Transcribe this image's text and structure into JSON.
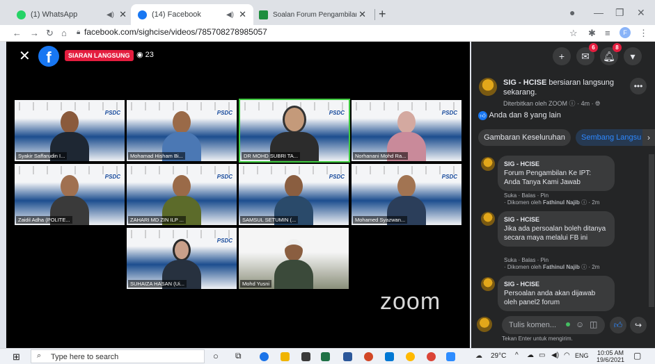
{
  "browser": {
    "tabs": [
      {
        "title": "(1) WhatsApp",
        "color": "#25d366"
      },
      {
        "title": "(14) Facebook",
        "color": "#1877f2"
      },
      {
        "title": "Soalan Forum Pengambilan ke IP",
        "color": "#1e8e3e"
      }
    ],
    "url": "facebook.com/sighcise/videos/785708278985057",
    "profile_initial": "F"
  },
  "video": {
    "live_label": "SIARAN LANGSUNG",
    "viewers": "23",
    "zoom_logo": "zoom",
    "tile_brand": "PSDC",
    "participants": [
      {
        "name": "Syakir Saffarudin I..."
      },
      {
        "name": "Mohamad Hisham Bi..."
      },
      {
        "name": "DR MOHD SUBRI TA..."
      },
      {
        "name": "Norhanani Mohd Ra..."
      },
      {
        "name": "Zaidil Adha (POLITE..."
      },
      {
        "name": "ZAHARI MD ZIN ILP ..."
      },
      {
        "name": "SAMSUL SETUMIN (..."
      },
      {
        "name": "Mohamed Syazwan..."
      },
      {
        "name": "SUHAIZA HASAN (Ui..."
      },
      {
        "name": "Mohd Yusni"
      }
    ]
  },
  "sidebar": {
    "badges": {
      "messenger": "6",
      "notifications": "8"
    },
    "post": {
      "page": "SIG - HCISE",
      "action": "bersiaran langsung sekarang.",
      "published": "Diterbitkan oleh ZOOM",
      "time": "4m",
      "reactions": "Anda dan 8 yang lain"
    },
    "tabs": [
      "Gambaran Keseluruhan",
      "Sembang Langsu"
    ],
    "comments": [
      {
        "author": "SIG - HCISE",
        "text": "Forum Pengambilan Ke IPT: Anda Tanya Kami Jawab",
        "actions": "Suka · Balas · Pin",
        "by_prefix": "· Dikomen oleh",
        "by": "Fathinul Najib",
        "time": "2m"
      },
      {
        "author": "SIG - HCISE",
        "text": "Jika ada persoalan boleh ditanya secara maya melalui FB ini",
        "actions": "Suka · Balas · Pin",
        "by_prefix": "· Dikomen oleh",
        "by": "Fathinul Najib",
        "time": "2m"
      },
      {
        "author": "SIG - HCISE",
        "text": "Persoalan anda akan dijawab oleh panel2 forum"
      }
    ],
    "comment_placeholder": "Tulis komen...",
    "enter_hint": "Tekan Enter untuk mengirim."
  },
  "taskbar": {
    "search_placeholder": "Type here to search",
    "temp": "29°C",
    "lang": "ENG",
    "time": "10:05 AM",
    "date": "19/6/2021"
  }
}
